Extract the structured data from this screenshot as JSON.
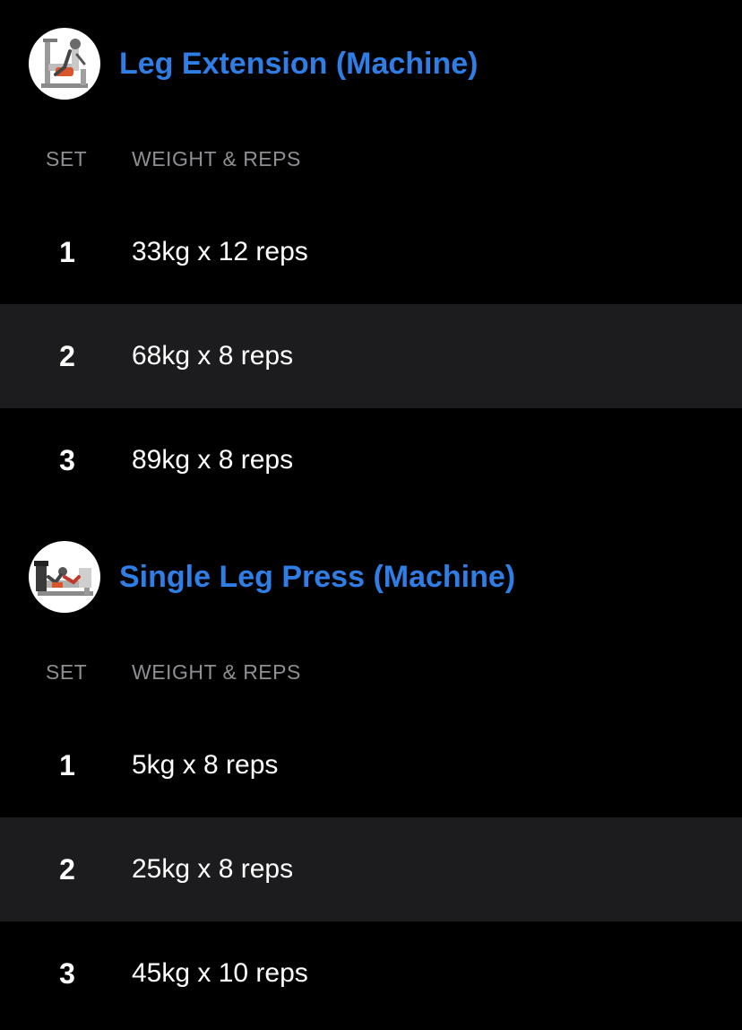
{
  "colors": {
    "background": "#000000",
    "alt_row": "#1c1c1e",
    "accent": "#2f7ee6",
    "muted": "#8e8e93"
  },
  "exercises": [
    {
      "name": "Leg Extension (Machine)",
      "thumbnail_icon": "leg-extension-machine-icon",
      "headers": {
        "set": "SET",
        "weight_reps": "WEIGHT & REPS"
      },
      "sets": [
        {
          "number": "1",
          "value": "33kg x 12 reps"
        },
        {
          "number": "2",
          "value": "68kg x 8 reps"
        },
        {
          "number": "3",
          "value": "89kg x 8 reps"
        }
      ]
    },
    {
      "name": "Single Leg Press (Machine)",
      "thumbnail_icon": "leg-press-machine-icon",
      "headers": {
        "set": "SET",
        "weight_reps": "WEIGHT & REPS"
      },
      "sets": [
        {
          "number": "1",
          "value": "5kg x 8 reps"
        },
        {
          "number": "2",
          "value": "25kg x 8 reps"
        },
        {
          "number": "3",
          "value": "45kg x 10 reps"
        }
      ]
    }
  ]
}
